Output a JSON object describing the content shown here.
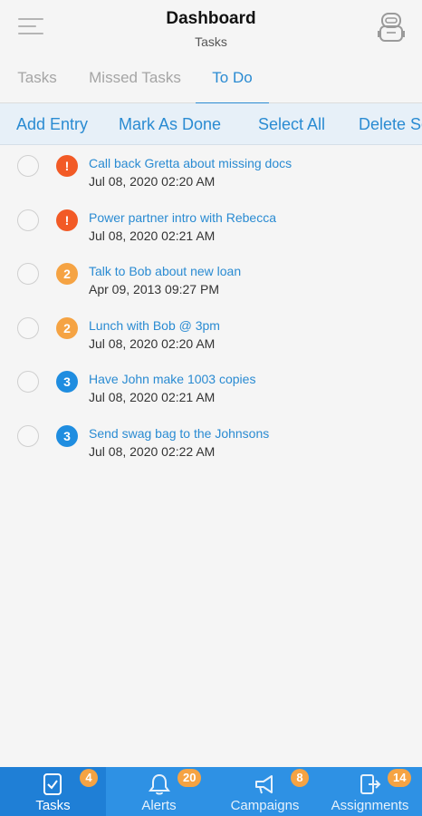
{
  "header": {
    "title": "Dashboard",
    "subtitle": "Tasks",
    "menu_icon": "hamburger-menu-icon",
    "profile_icon": "robot-avatar-icon"
  },
  "tabs": [
    {
      "label": "Tasks",
      "active": false
    },
    {
      "label": "Missed Tasks",
      "active": false
    },
    {
      "label": "To Do",
      "active": true
    }
  ],
  "actions": [
    {
      "label": "Add Entry"
    },
    {
      "label": "Mark As Done"
    },
    {
      "label": "Select All"
    },
    {
      "label": "Delete Se"
    }
  ],
  "colors": {
    "accent": "#2a8bd2",
    "priority_high": "#f25a26",
    "priority_medium": "#f5a343",
    "priority_low": "#1f8de0",
    "nav_background": "#2e91e4",
    "nav_badge": "#f5a343"
  },
  "tasks": [
    {
      "priority": "!",
      "level": "high",
      "title": "Call back Gretta about missing docs",
      "date": "Jul 08, 2020 02:20 AM",
      "checked": false
    },
    {
      "priority": "!",
      "level": "high",
      "title": "Power partner intro with Rebecca",
      "date": "Jul 08, 2020 02:21 AM",
      "checked": false
    },
    {
      "priority": "2",
      "level": "medium",
      "title": "Talk to Bob about new loan",
      "date": "Apr 09, 2013 09:27 PM",
      "checked": false
    },
    {
      "priority": "2",
      "level": "medium",
      "title": "Lunch with Bob @ 3pm",
      "date": "Jul 08, 2020 02:20 AM",
      "checked": false
    },
    {
      "priority": "3",
      "level": "low",
      "title": "Have John make 1003 copies",
      "date": "Jul 08, 2020 02:21 AM",
      "checked": false
    },
    {
      "priority": "3",
      "level": "low",
      "title": "Send swag bag to the Johnsons",
      "date": "Jul 08, 2020 02:22 AM",
      "checked": false
    }
  ],
  "bottom_nav": [
    {
      "label": "Tasks",
      "badge": "4",
      "icon": "task-checklist-icon",
      "active": true
    },
    {
      "label": "Alerts",
      "badge": "20",
      "icon": "bell-icon",
      "active": false
    },
    {
      "label": "Campaigns",
      "badge": "8",
      "icon": "megaphone-icon",
      "active": false
    },
    {
      "label": "Assignments",
      "badge": "14",
      "icon": "export-door-icon",
      "active": false
    }
  ]
}
